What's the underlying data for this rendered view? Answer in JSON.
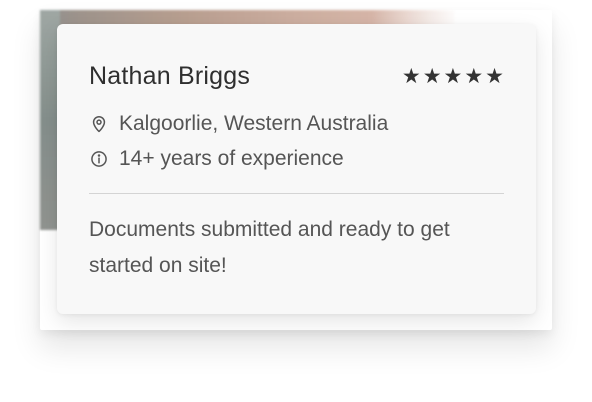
{
  "profile": {
    "name": "Nathan Briggs",
    "rating_stars": 5,
    "stars": [
      "★",
      "★",
      "★",
      "★",
      "★"
    ],
    "location": "Kalgoorlie, Western Australia",
    "experience": "14+ years of experience",
    "message": "Documents submitted and ready to get started on site!"
  },
  "icons": {
    "location": "location-pin-icon",
    "experience": "info-icon",
    "rating": "star-icon"
  },
  "colors": {
    "card_background": "#f8f8f8",
    "name_text": "#2f2f2f",
    "body_text": "#555555",
    "stars": "#333333",
    "divider": "#d4d4d4"
  }
}
